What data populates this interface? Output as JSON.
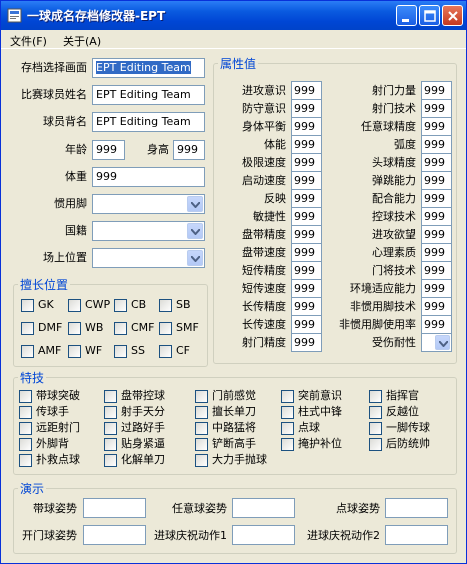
{
  "window": {
    "title": "一球成名存档修改器-EPT"
  },
  "menu": {
    "file": "文件(F)",
    "about": "关于(A)"
  },
  "top_fields": {
    "save_select": {
      "label": "存档选择画面",
      "value": "EPT Editing Team"
    },
    "match_name": {
      "label": "比赛球员姓名",
      "value": "EPT Editing Team"
    },
    "back_name": {
      "label": "球员背名",
      "value": "EPT Editing Team"
    },
    "age": {
      "label": "年龄",
      "value": "999"
    },
    "height": {
      "label": "身高",
      "value": "999"
    },
    "weight": {
      "label": "体重",
      "value": "999"
    },
    "foot": {
      "label": "惯用脚",
      "value": ""
    },
    "nationality": {
      "label": "国籍",
      "value": ""
    },
    "field_position": {
      "label": "场上位置",
      "value": ""
    }
  },
  "positions": {
    "title": "擅长位置",
    "items": [
      "GK",
      "CWP",
      "CB",
      "SB",
      "DMF",
      "WB",
      "CMF",
      "SMF",
      "AMF",
      "WF",
      "SS",
      "CF"
    ]
  },
  "attributes": {
    "title": "属性值",
    "left": [
      {
        "label": "进攻意识",
        "value": "999"
      },
      {
        "label": "防守意识",
        "value": "999"
      },
      {
        "label": "身体平衡",
        "value": "999"
      },
      {
        "label": "体能",
        "value": "999"
      },
      {
        "label": "极限速度",
        "value": "999"
      },
      {
        "label": "启动速度",
        "value": "999"
      },
      {
        "label": "反映",
        "value": "999"
      },
      {
        "label": "敏捷性",
        "value": "999"
      },
      {
        "label": "盘带精度",
        "value": "999"
      },
      {
        "label": "盘带速度",
        "value": "999"
      },
      {
        "label": "短传精度",
        "value": "999"
      },
      {
        "label": "短传速度",
        "value": "999"
      },
      {
        "label": "长传精度",
        "value": "999"
      },
      {
        "label": "长传速度",
        "value": "999"
      },
      {
        "label": "射门精度",
        "value": "999"
      }
    ],
    "right": [
      {
        "label": "射门力量",
        "value": "999"
      },
      {
        "label": "射门技术",
        "value": "999"
      },
      {
        "label": "任意球精度",
        "value": "999"
      },
      {
        "label": "弧度",
        "value": "999"
      },
      {
        "label": "头球精度",
        "value": "999"
      },
      {
        "label": "弹跳能力",
        "value": "999"
      },
      {
        "label": "配合能力",
        "value": "999"
      },
      {
        "label": "控球技术",
        "value": "999"
      },
      {
        "label": "进攻欲望",
        "value": "999"
      },
      {
        "label": "心理素质",
        "value": "999"
      },
      {
        "label": "门将技术",
        "value": "999"
      },
      {
        "label": "环境适应能力",
        "value": "999"
      },
      {
        "label": "非惯用脚技术",
        "value": "999"
      },
      {
        "label": "非惯用脚使用率",
        "value": "999"
      },
      {
        "label": "受伤耐性",
        "value": ""
      }
    ]
  },
  "skills": {
    "title": "特技",
    "rows": [
      [
        "带球突破",
        "盘带控球",
        "门前感觉",
        "突前意识",
        "指挥官"
      ],
      [
        "传球手",
        "射手天分",
        "擅长单刀",
        "柱式中锋",
        "反越位"
      ],
      [
        "远距射门",
        "过路好手",
        "中路猛将",
        "点球",
        "一脚传球"
      ],
      [
        "外脚背",
        "贴身紧逼",
        "铲断高手",
        "掩护补位",
        "后防统帅"
      ],
      [
        "扑救点球",
        "化解单刀",
        "大力手抛球"
      ]
    ]
  },
  "demo": {
    "title": "演示",
    "row1": [
      "带球姿势",
      "任意球姿势",
      "点球姿势"
    ],
    "row2": [
      "开门球姿势",
      "进球庆祝动作1",
      "进球庆祝动作2"
    ]
  }
}
